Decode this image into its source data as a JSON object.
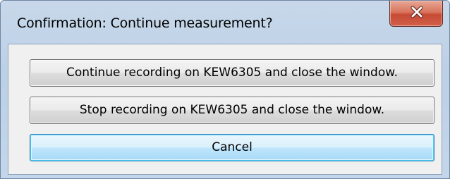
{
  "window": {
    "title": "Confirmation: Continue measurement?",
    "close_icon": "close-icon"
  },
  "buttons": {
    "continue_label": "Continue recording on KEW6305 and close the window.",
    "stop_label": "Stop recording on KEW6305 and close the window.",
    "cancel_label": "Cancel"
  },
  "colors": {
    "close_button": "#c64a34",
    "default_button_border": "#3c7fb1"
  }
}
